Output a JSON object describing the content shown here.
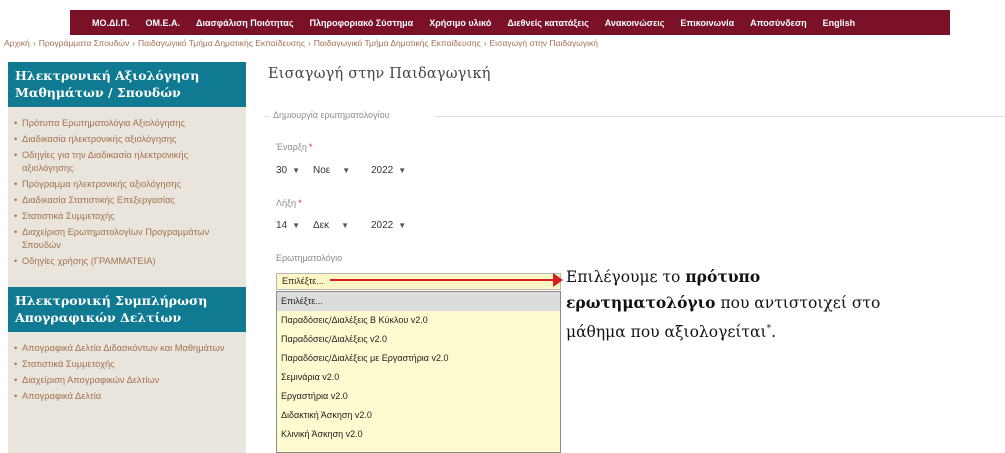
{
  "topnav": {
    "items": [
      "ΜΟ.ΔΙ.Π.",
      "ΟΜ.Ε.Α.",
      "Διασφάλιση Ποιότητας",
      "Πληροφοριακό Σύστημα",
      "Χρήσιμο υλικό",
      "Διεθνείς κατατάξεις",
      "Ανακοινώσεις",
      "Επικοινωνία",
      "Αποσύνδεση",
      "English"
    ]
  },
  "breadcrumb": {
    "items": [
      "Αρχική",
      "Προγράμματα Σπουδών",
      "Παιδαγωγικό Τμήμα Δημοτικής Εκπαίδευσης",
      "Παιδαγωγικό Τμήμα Δημοτικής Εκπαίδευσης"
    ],
    "current": "Εισαγωγή στην Παιδαγωγική",
    "separator": "›"
  },
  "sidebar": {
    "section1": {
      "title": "Ηλεκτρονική Αξιολόγηση Μαθημάτων / Σπουδών",
      "items": [
        "Πρότυπα Ερωτηματολόγια Αξιολόγησης",
        "Διαδικασία ηλεκτρονικής αξιολόγησης",
        "Οδηγίες για την Διαδικασία ηλεκτρονικής αξιολόγησης",
        "Πρόγραμμα ηλεκτρονικής αξιολόγησης",
        "Διαδικασία Στατιστικής Επεξεργασίας",
        "Στατιστικά Συμμετοχής",
        "Διαχείριση Ερωτηματολογίων Προγραμμάτων Σπουδών",
        "Οδηγίες χρήσης (ΓΡΑΜΜΑΤΕΙΑ)"
      ]
    },
    "section2": {
      "title": "Ηλεκτρονική Συμπλήρωση Απογραφικών Δελτίων",
      "items": [
        "Απογραφικά Δελτία Διδασκόντων και Μαθημάτων",
        "Στατιστικά Συμμετοχής",
        "Διαχείριση Απογραφικών Δελτίων",
        "Απογραφικά Δελτία"
      ]
    }
  },
  "main": {
    "title": "Εισαγωγή στην Παιδαγωγική",
    "legend": "Δημιουργία ερωτηματολογίου",
    "start": {
      "label": "Έναρξη",
      "required_mark": "*",
      "day": "30",
      "month": "Νοε",
      "year": "2022"
    },
    "end": {
      "label": "Λήξη",
      "required_mark": "*",
      "day": "14",
      "month": "Δεκ",
      "year": "2022"
    },
    "questionnaire": {
      "label": "Ερωτηματολόγιο",
      "value": "Επιλέξτε...",
      "options": [
        "Επιλέξτε...",
        "Παραδόσεις/Διαλέξεις Β Κύκλου v2.0",
        "Παραδόσεις/Διαλέξεις v2.0",
        "Παραδόσεις/Διαλέξεις με Εργαστήρια v2.0",
        "Σεμινάρια v2.0",
        "Εργαστήρια v2.0",
        "Διδακτική Άσκηση v2.0",
        "Κλινική Άσκηση v2.0"
      ]
    }
  },
  "annotation": {
    "line1_prefix": "Επιλέγουμε το ",
    "line1_bold": "πρότυπο",
    "line2_bold": "ερωτηματολόγιο",
    "line2_rest": " που αντιστοιχεί στο",
    "line3": "μάθημα που αξιολογείται",
    "line3_sup": "*",
    "line3_end": ".",
    "arrow_color": "#d81e1e"
  },
  "colors": {
    "nav_bg": "#7a1128",
    "sidebar_header_bg": "#0f7a92",
    "sidebar_bg": "#e9e5dd",
    "link": "#a3714f",
    "select_bg": "#fff8c6"
  }
}
